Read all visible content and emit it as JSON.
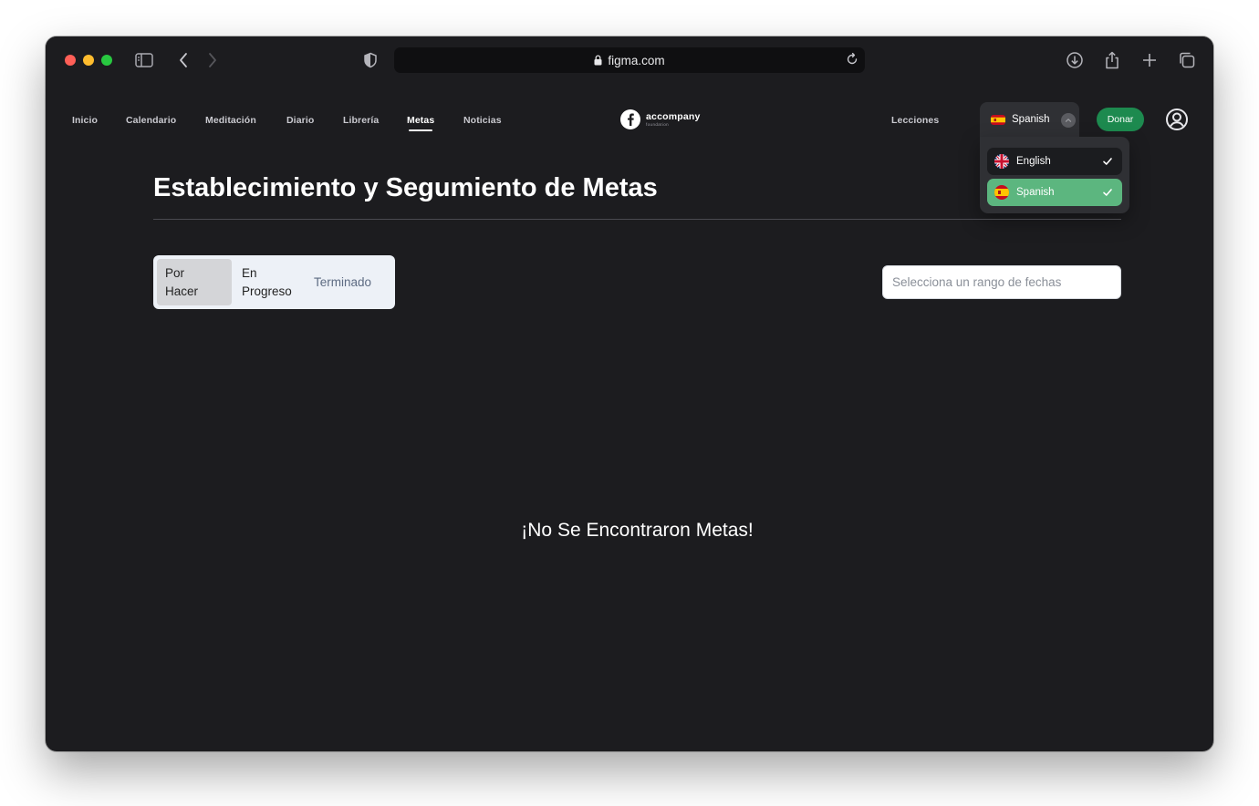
{
  "browser": {
    "url": "figma.com",
    "icons": [
      "sidebar-icon",
      "back-icon",
      "forward-icon",
      "shield-icon",
      "lock-icon",
      "reload-icon",
      "download-icon",
      "share-icon",
      "new-tab-icon",
      "tabs-overview-icon"
    ]
  },
  "nav": {
    "items": [
      {
        "label": "Inicio"
      },
      {
        "label": "Calendario"
      },
      {
        "label": "Meditación"
      },
      {
        "label": "Diario"
      },
      {
        "label": "Librería"
      },
      {
        "label": "Metas"
      },
      {
        "label": "Noticias"
      }
    ],
    "active": "Metas",
    "logo": {
      "word": "accompany",
      "sub": "foundation"
    },
    "lecciones": "Lecciones",
    "language": {
      "current": "Spanish",
      "options": [
        {
          "label": "English",
          "flag": "uk-flag-icon",
          "checked": true
        },
        {
          "label": "Spanish",
          "flag": "spain-flag-icon",
          "checked": true,
          "highlighted": true
        }
      ]
    },
    "donate": "Donar",
    "profile_icon": "user-circle-icon"
  },
  "main": {
    "title": "Establecimiento y Segumiento de Metas",
    "tabs": [
      {
        "line1": "Por",
        "line2": "Hacer",
        "selected": true
      },
      {
        "line1": "En",
        "line2": "Progreso",
        "selected": false
      },
      {
        "line1": "Terminado",
        "selected": false
      }
    ],
    "date_range": {
      "placeholder": "Selecciona un rango de fechas",
      "value": ""
    },
    "empty_message": "¡No Se Encontraron Metas!"
  },
  "colors": {
    "page_bg": "#1c1c1f",
    "accent_green": "#1d8a4f",
    "selected_language": "#5cb67f",
    "dropdown_bg": "#2f3034",
    "tab_bg": "#edf1f7"
  }
}
